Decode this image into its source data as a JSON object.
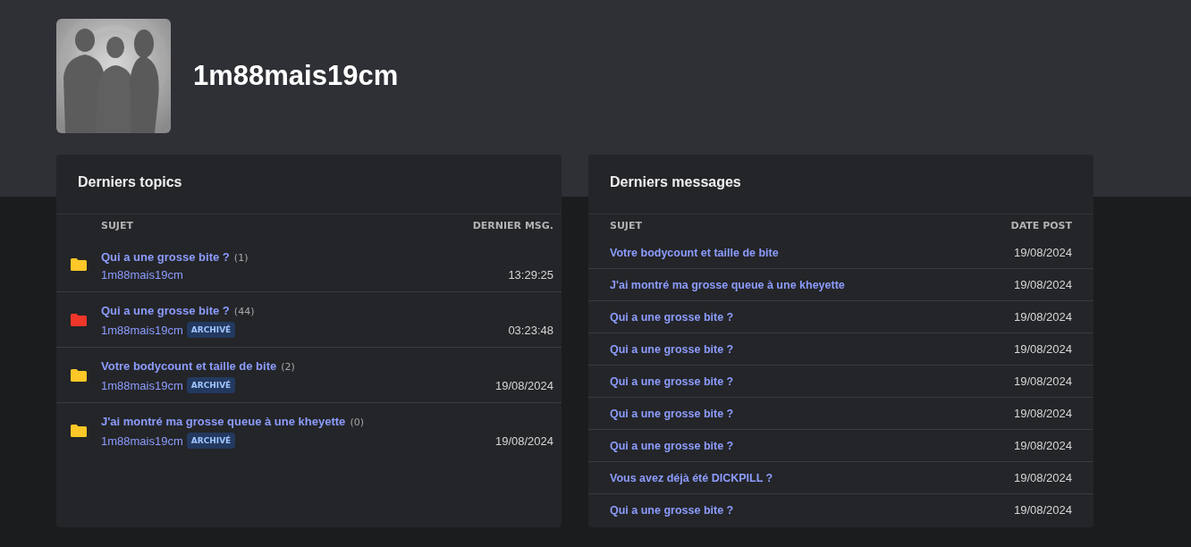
{
  "profile": {
    "username": "1m88mais19cm"
  },
  "latest_topics": {
    "title": "Derniers topics",
    "columns": [
      "SUJET",
      "DERNIER MSG."
    ],
    "rows": [
      {
        "color": "#ffc727",
        "title": "Qui a une grosse bite ?",
        "count": "(1)",
        "author": "1m88mais19cm",
        "last": "13:29:25"
      },
      {
        "color": "#f1362a",
        "title": "Qui a une grosse bite ?",
        "count": "(44)",
        "author": "1m88mais19cm",
        "badge": "ARCHIVÉ",
        "last": "03:23:48"
      },
      {
        "color": "#ffc727",
        "title": "Votre bodycount et taille de bite",
        "count": "(2)",
        "author": "1m88mais19cm",
        "badge": "ARCHIVÉ",
        "last": "19/08/2024"
      },
      {
        "color": "#ffc727",
        "title": "J'ai montré ma grosse queue à une kheyette",
        "count": "(0)",
        "author": "1m88mais19cm",
        "badge": "ARCHIVÉ",
        "last": "19/08/2024"
      }
    ]
  },
  "latest_messages": {
    "title": "Derniers messages",
    "columns": [
      "SUJET",
      "DATE POST"
    ],
    "rows": [
      {
        "subject": "Votre bodycount et taille de bite",
        "date": "19/08/2024"
      },
      {
        "subject": "J'ai montré ma grosse queue à une kheyette",
        "date": "19/08/2024"
      },
      {
        "subject": "Qui a une grosse bite ?",
        "date": "19/08/2024"
      },
      {
        "subject": "Qui a une grosse bite ?",
        "date": "19/08/2024"
      },
      {
        "subject": "Qui a une grosse bite ?",
        "date": "19/08/2024"
      },
      {
        "subject": "Qui a une grosse bite ?",
        "date": "19/08/2024"
      },
      {
        "subject": "Qui a une grosse bite ?",
        "date": "19/08/2024"
      },
      {
        "subject": "Vous avez déjà été DICKPILL ?",
        "date": "19/08/2024"
      },
      {
        "subject": "Qui a une grosse bite ?",
        "date": "19/08/2024"
      }
    ]
  }
}
